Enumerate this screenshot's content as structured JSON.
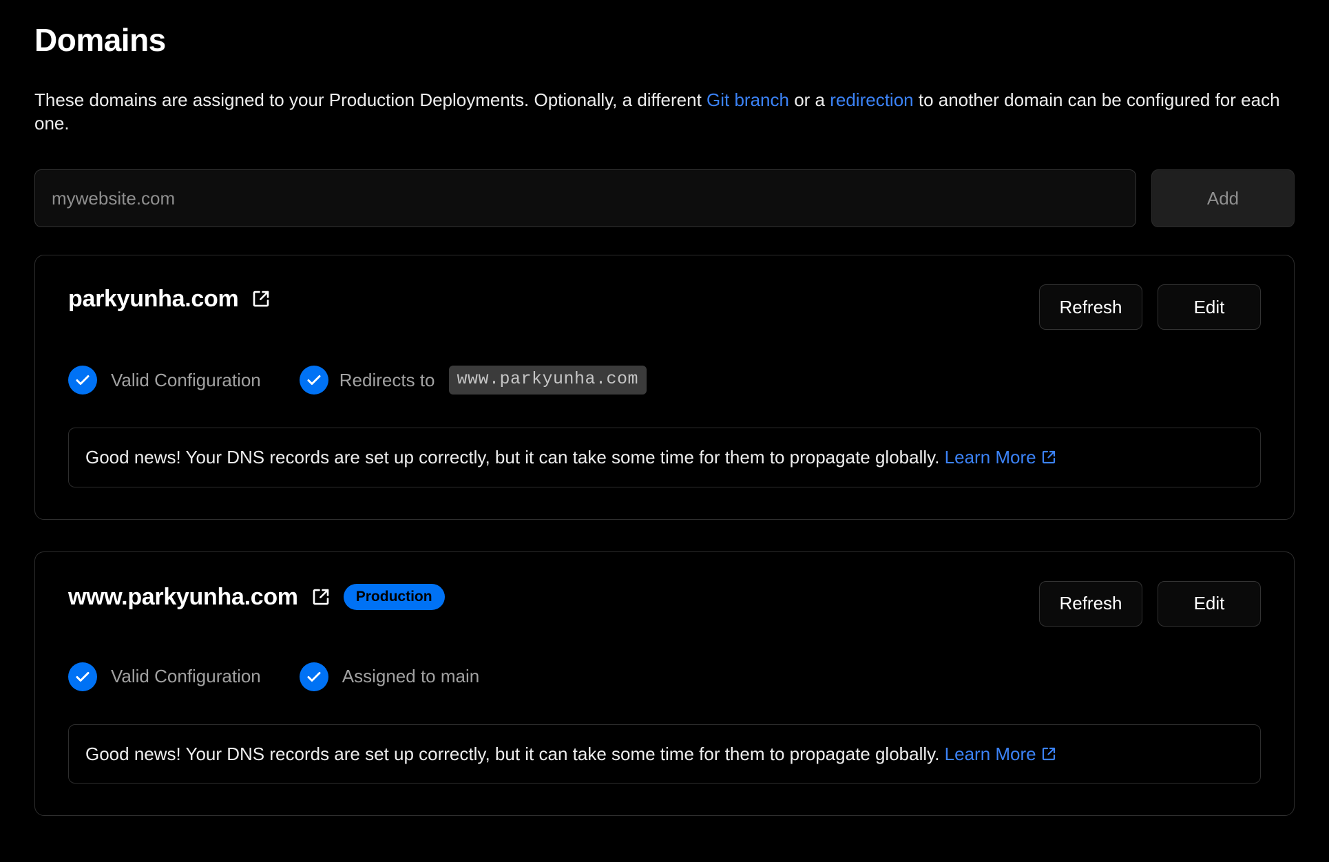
{
  "page": {
    "title": "Domains",
    "description_part1": "These domains are assigned to your Production Deployments. Optionally, a different ",
    "description_link1": "Git branch",
    "description_part2": " or a ",
    "description_link2": "redirection",
    "description_part3": " to another domain can be configured for each one."
  },
  "add_form": {
    "input_placeholder": "mywebsite.com",
    "input_value": "",
    "add_label": "Add"
  },
  "colors": {
    "accent_blue": "#0072f5",
    "link_blue": "#3b82f6",
    "page_background": "#000000",
    "card_border": "#2e2e2e",
    "muted_text": "#a1a1a1"
  },
  "domains": [
    {
      "name": "parkyunha.com",
      "external_link_icon": "external-link-icon",
      "badge": null,
      "refresh_label": "Refresh",
      "edit_label": "Edit",
      "statuses": [
        {
          "icon": "check-circle-icon",
          "label": "Valid Configuration",
          "code": null
        },
        {
          "icon": "check-circle-icon",
          "label": "Redirects to",
          "code": "www.parkyunha.com"
        }
      ],
      "notice": {
        "text": "Good news! Your DNS records are set up correctly, but it can take some time for them to propagate globally.",
        "link_label": "Learn More",
        "link_icon": "external-link-icon"
      }
    },
    {
      "name": "www.parkyunha.com",
      "external_link_icon": "external-link-icon",
      "badge": "Production",
      "refresh_label": "Refresh",
      "edit_label": "Edit",
      "statuses": [
        {
          "icon": "check-circle-icon",
          "label": "Valid Configuration",
          "code": null
        },
        {
          "icon": "check-circle-icon",
          "label": "Assigned to main",
          "code": null
        }
      ],
      "notice": {
        "text": "Good news! Your DNS records are set up correctly, but it can take some time for them to propagate globally.",
        "link_label": "Learn More",
        "link_icon": "external-link-icon"
      }
    }
  ]
}
